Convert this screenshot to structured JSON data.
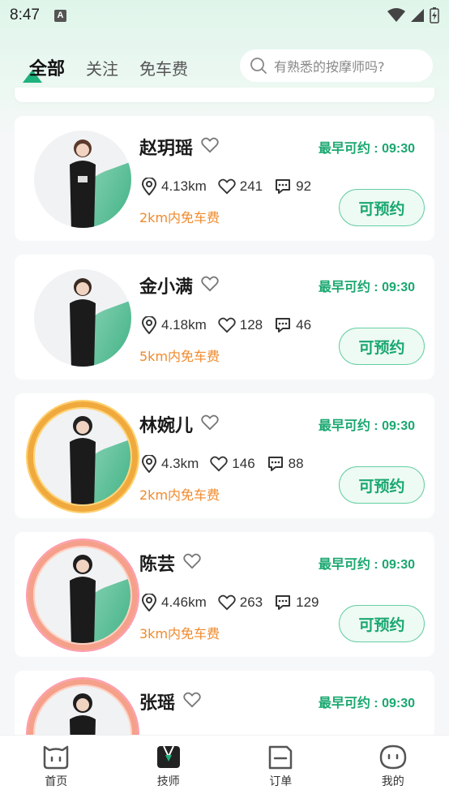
{
  "status_bar": {
    "time": "8:47",
    "notification_badge": "A"
  },
  "header": {
    "tabs": [
      {
        "label": "全部",
        "active": true
      },
      {
        "label": "关注",
        "active": false
      },
      {
        "label": "免车费",
        "active": false
      }
    ],
    "search": {
      "placeholder": "有熟悉的按摩师吗?"
    }
  },
  "colors": {
    "accent": "#1aa870",
    "free_fare": "#f08a2c"
  },
  "therapists": [
    {
      "name": "赵玥瑶",
      "earliest": "最早可约 : 09:30",
      "distance": "4.13km",
      "likes": "241",
      "comments": "92",
      "free_fare": "2km内免车费",
      "book_label": "可预约",
      "frame": "none"
    },
    {
      "name": "金小满",
      "earliest": "最早可约 : 09:30",
      "distance": "4.18km",
      "likes": "128",
      "comments": "46",
      "free_fare": "5km内免车费",
      "book_label": "可预约",
      "frame": "none"
    },
    {
      "name": "林婉儿",
      "earliest": "最早可约 : 09:30",
      "distance": "4.3km",
      "likes": "146",
      "comments": "88",
      "free_fare": "2km内免车费",
      "book_label": "可预约",
      "frame": "gold"
    },
    {
      "name": "陈芸",
      "earliest": "最早可约 : 09:30",
      "distance": "4.46km",
      "likes": "263",
      "comments": "129",
      "free_fare": "3km内免车费",
      "book_label": "可预约",
      "frame": "pink"
    },
    {
      "name": "张瑶",
      "earliest": "最早可约 : 09:30",
      "distance": "",
      "likes": "",
      "comments": "",
      "free_fare": "",
      "book_label": "",
      "frame": "pink"
    }
  ],
  "bottom_nav": [
    {
      "label": "首页",
      "icon": "home-icon",
      "active": false
    },
    {
      "label": "技师",
      "icon": "technician-icon",
      "active": true
    },
    {
      "label": "订单",
      "icon": "order-icon",
      "active": false
    },
    {
      "label": "我的",
      "icon": "profile-icon",
      "active": false
    }
  ]
}
